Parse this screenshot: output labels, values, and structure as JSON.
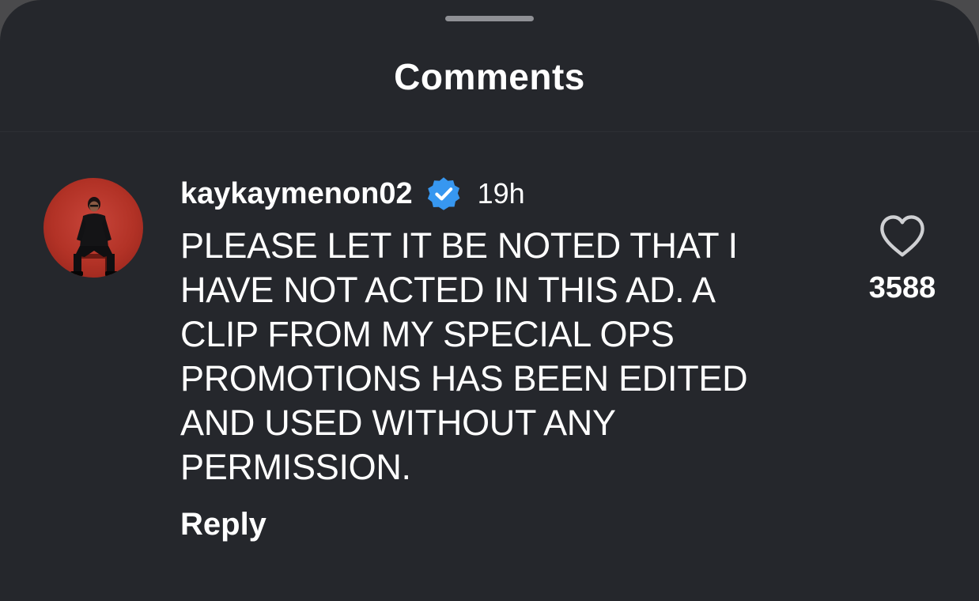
{
  "sheet": {
    "title": "Comments"
  },
  "comment": {
    "username": "kaykaymenon02",
    "verified": true,
    "verified_icon": "verified-badge-icon",
    "timestamp": "19h",
    "text": "PLEASE LET IT BE NOTED THAT I\nHAVE NOT ACTED IN THIS AD. A\nCLIP FROM MY SPECIAL OPS\nPROMOTIONS HAS BEEN EDITED\nAND USED WITHOUT ANY\nPERMISSION.",
    "reply_label": "Reply",
    "like_icon": "heart-outline-icon",
    "like_count": "3588"
  },
  "colors": {
    "background": "#25272c",
    "text": "#ffffff",
    "verified": "#3797f0",
    "avatar_bg": "#b23226",
    "handle": "#8f9095"
  }
}
